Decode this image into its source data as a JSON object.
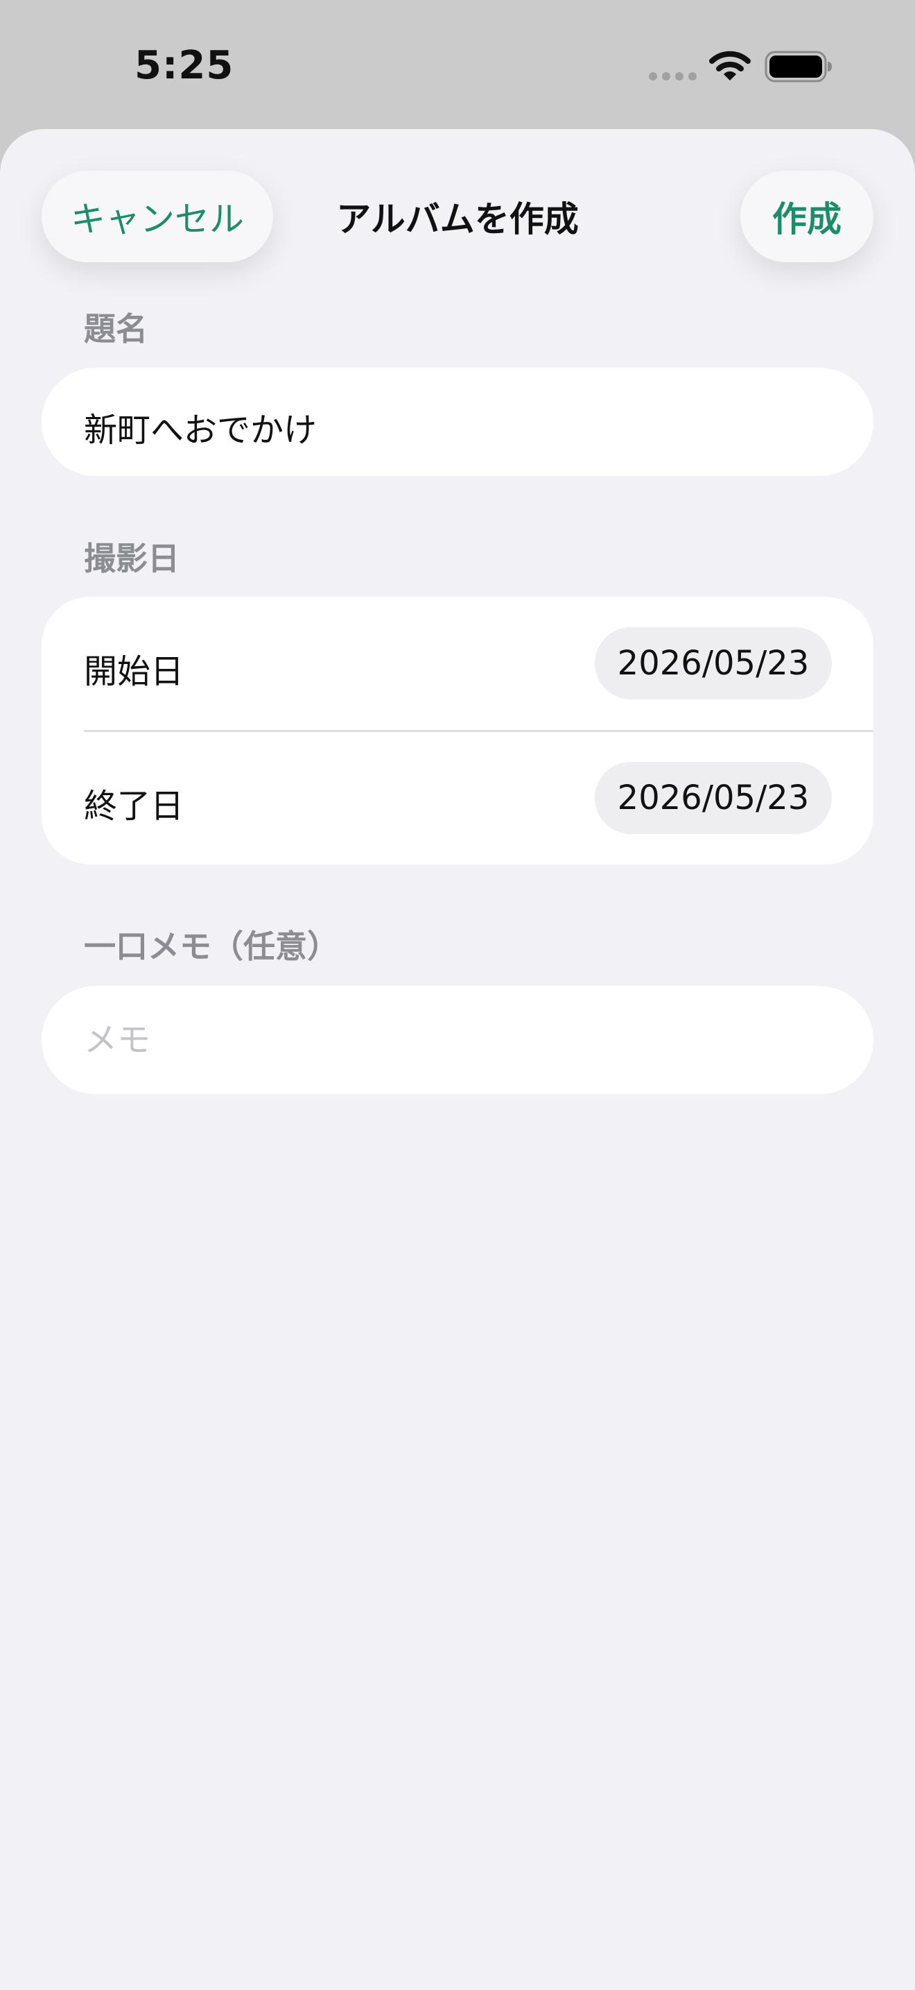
{
  "status_bar": {
    "time": "5:25",
    "icons": [
      "signal-icon",
      "wifi-icon",
      "battery-icon"
    ]
  },
  "sheet": {
    "title": "アルバムを作成",
    "cancel_label": "キャンセル",
    "create_label": "作成"
  },
  "form": {
    "title_label": "題名",
    "title_value": "新町へおでかけ",
    "date_label": "撮影日",
    "start_label": "開始日",
    "start_value": "2026/05/23",
    "end_label": "終了日",
    "end_value": "2026/05/23",
    "memo_label": "一口メモ（任意）",
    "memo_placeholder": "メモ",
    "memo_value": ""
  },
  "colors": {
    "accent": "#1e8b6a",
    "sheet_background": "#f1f1f6",
    "field_background": "#ffffff",
    "secondary_label": "#8c8c93",
    "date_pill_background": "#eeeef0"
  }
}
